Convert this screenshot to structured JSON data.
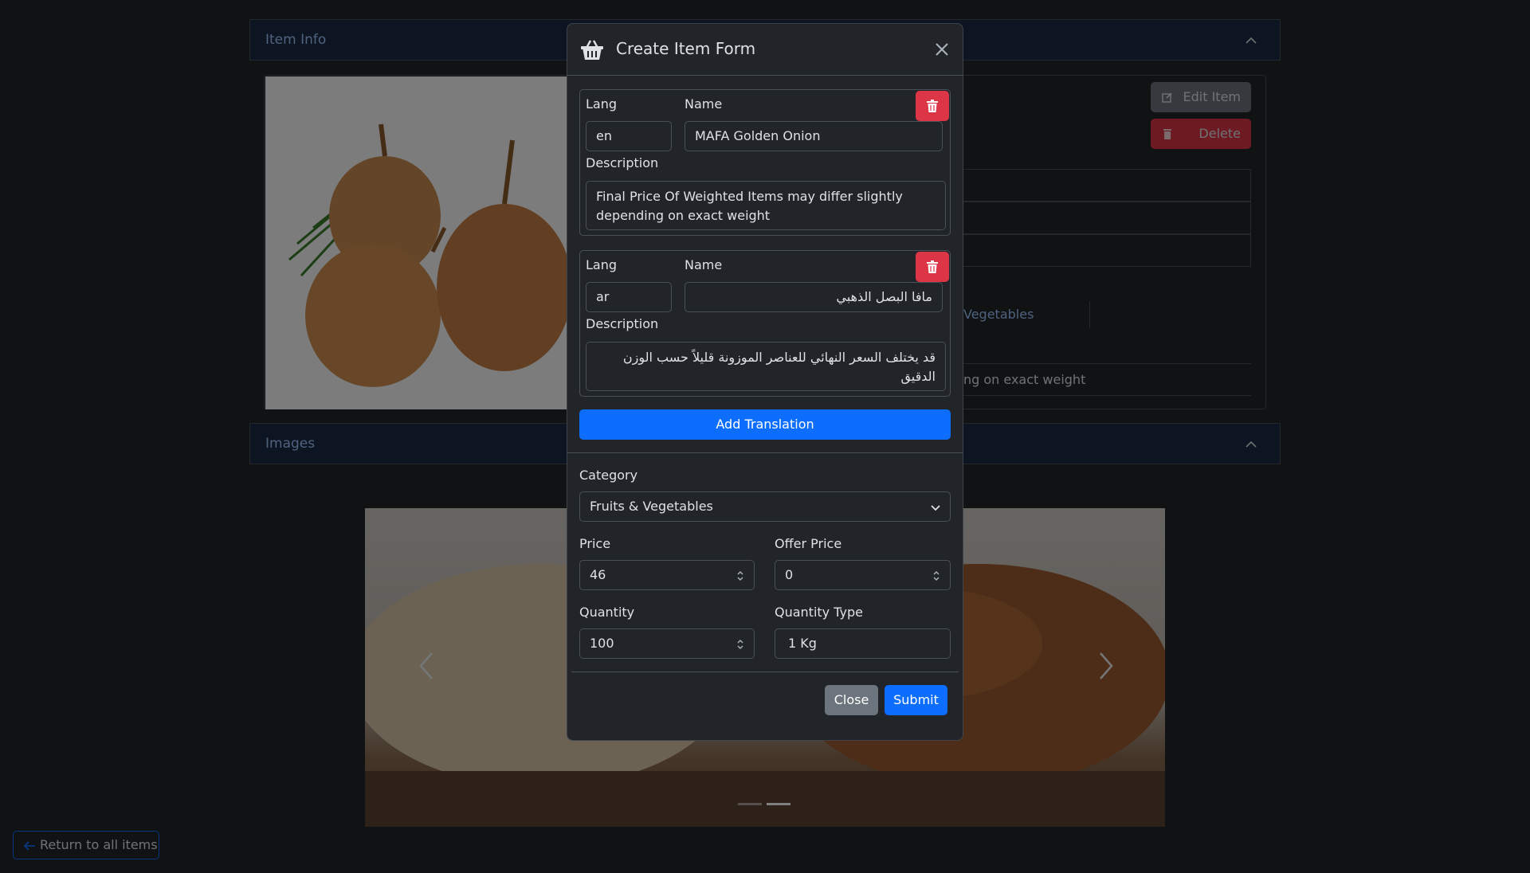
{
  "background": {
    "item_info_title": "Item Info",
    "images_title": "Images",
    "edit_item_label": "Edit Item",
    "delete_label": "Delete",
    "category_text": "Vegetables",
    "description_tail": "ng on exact weight",
    "return_label": "Return to all items"
  },
  "modal": {
    "title": "Create Item Form",
    "title_icon": "basket-icon",
    "translations": [
      {
        "lang_label": "Lang",
        "lang_value": "en",
        "name_label": "Name",
        "name_value": "MAFA Golden Onion",
        "description_label": "Description",
        "description_value": "Final Price Of Weighted Items may differ slightly depending on exact weight"
      },
      {
        "lang_label": "Lang",
        "lang_value": "ar",
        "name_label": "Name",
        "name_value": "مافا البصل الذهبي",
        "description_label": "Description",
        "description_value": "قد يختلف السعر النهائي للعناصر الموزونة قليلاً حسب الوزن الدقيق"
      }
    ],
    "add_translation_label": "Add Translation",
    "category": {
      "label": "Category",
      "value": "Fruits & Vegetables"
    },
    "price": {
      "label": "Price",
      "value": "46"
    },
    "offer_price": {
      "label": "Offer Price",
      "value": "0"
    },
    "quantity": {
      "label": "Quantity",
      "value": "100"
    },
    "quantity_type": {
      "label": "Quantity Type",
      "value": "1 Kg"
    },
    "close_label": "Close",
    "submit_label": "Submit"
  },
  "colors": {
    "primary": "#0d6efd",
    "danger": "#dc3545",
    "secondary": "#6c757d",
    "body_bg": "#212529"
  }
}
